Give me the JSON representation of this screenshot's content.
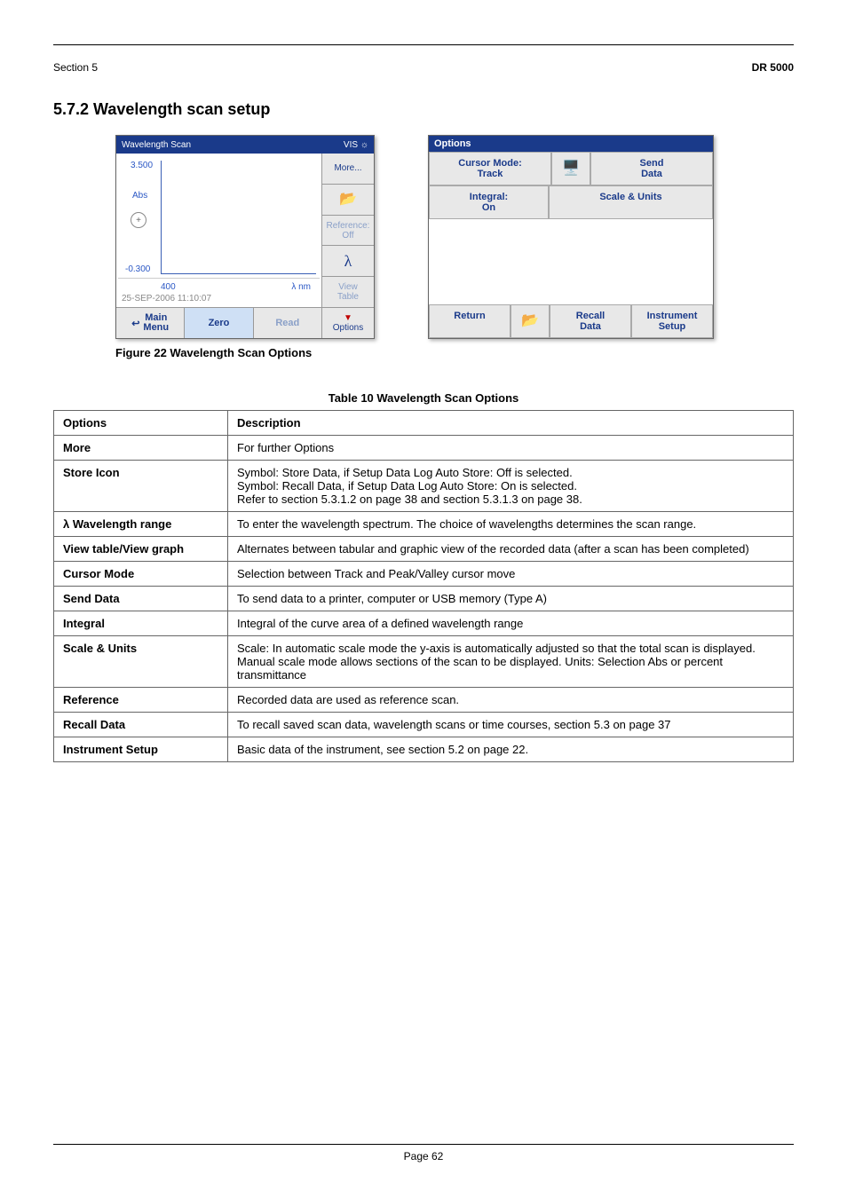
{
  "header": {
    "section_ref": "Section 5",
    "product": "DR 5000",
    "heading": "5.7.2 Wavelength scan setup"
  },
  "ws": {
    "title": "Wavelength Scan",
    "mode": "VIS",
    "ymax": "3.500",
    "ylabel": "Abs",
    "ymin": "-0.300",
    "xmin": "400",
    "xlabel": "λ nm",
    "timestamp": "25-SEP-2006  11:10:07",
    "right": {
      "more": "More...",
      "folder": "",
      "ref_line1": "Reference:",
      "ref_line2": "Off",
      "lambda": "λ",
      "view_line1": "View",
      "view_line2": "Table",
      "opt_icon": "▼",
      "opt_label": "Options"
    },
    "bottom": {
      "main_l1": "Main",
      "main_l2": "Menu",
      "zero": "Zero",
      "read": "Read"
    }
  },
  "options": {
    "title": "Options",
    "r1": {
      "cursor_l1": "Cursor Mode:",
      "cursor_l2": "Track",
      "send_l1": "Send",
      "send_l2": "Data"
    },
    "r2": {
      "int_l1": "Integral:",
      "int_l2": "On",
      "scale": "Scale & Units"
    },
    "bottom": {
      "return": "Return",
      "recall_l1": "Recall",
      "recall_l2": "Data",
      "inst_l1": "Instrument",
      "inst_l2": "Setup"
    }
  },
  "fig_caption": "Figure 22 Wavelength Scan Options",
  "table_caption": "Table 10 Wavelength Scan Options",
  "rows": {
    "h1": "Options",
    "h2": "Description",
    "more": "More",
    "more_d": "For further Options",
    "store": "Store Icon",
    "store_sym": "Symbol: Store Data, if Setup Data Log Auto Store: Off is selected.",
    "store_sym2": "Symbol: Recall Data, if Setup Data Log Auto Store: On is selected.",
    "store_ref": "Refer to section 5.3.1.2 on page 38 and section 5.3.1.3 on page 38.",
    "lambda": "λ Wavelength range",
    "lambda_d": "To enter the wavelength spectrum. The choice of wavelengths determines the scan range.",
    "view": "View table/View graph",
    "view_d": "Alternates between tabular and graphic view of the recorded data (after a scan has been completed)",
    "cursor": "Cursor Mode",
    "cursor_d": "Selection between Track and Peak/Valley cursor move",
    "send": "Send Data",
    "send_d": "To send data to a printer, computer or USB memory (Type A)",
    "integral": "Integral",
    "integral_d": "Integral of the curve area of a defined wavelength range",
    "scale": "Scale & Units",
    "scale_d": "Scale: In automatic scale mode the y-axis is automatically adjusted so that the total scan is displayed. Manual scale mode allows sections of the scan to be displayed. Units: Selection Abs or percent transmittance",
    "ref": "Reference",
    "ref_d": "Recorded data are used as reference scan.",
    "recall": "Recall Data",
    "recall_d": "To recall saved scan data, wavelength scans or time courses, section 5.3 on page 37",
    "inst": "Instrument Setup",
    "inst_d": "Basic data of the instrument, see section 5.2 on page 22."
  },
  "footer": "Page 62",
  "chart_data": {
    "type": "line",
    "title": "Wavelength Scan",
    "xlabel": "λ nm",
    "ylabel": "Abs",
    "xmin": 400,
    "ylim": [
      -0.3,
      3.5
    ],
    "series": [],
    "note": "empty plot area (no data curve shown)"
  }
}
